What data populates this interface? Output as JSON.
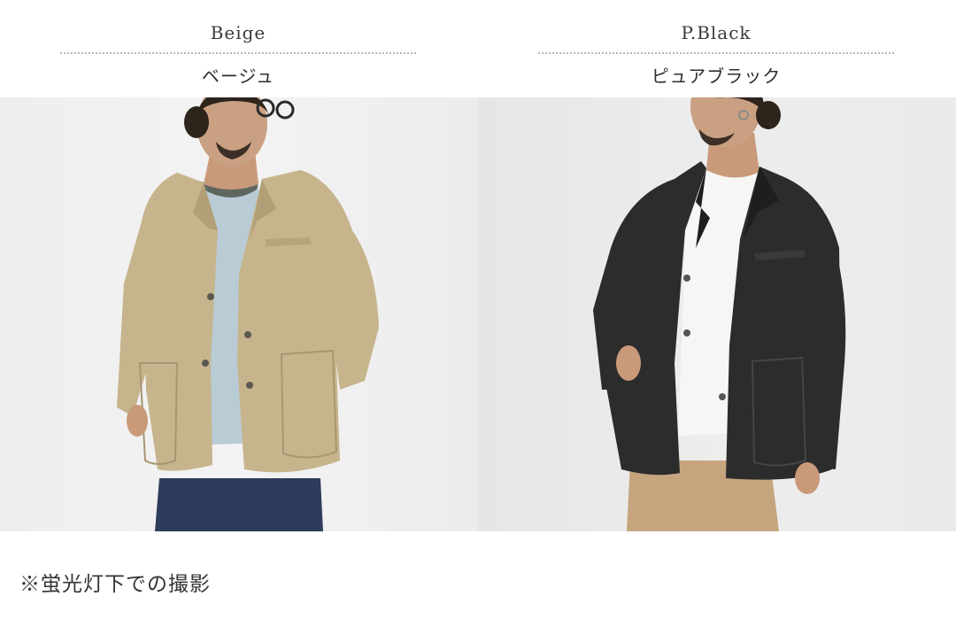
{
  "colors": {
    "left": {
      "label_en": "Beige",
      "label_jp": "ベージュ",
      "jacket": "#c6b48c",
      "shirt": "#b9cbd4",
      "pants": "#2f3b5c"
    },
    "right": {
      "label_en": "P.Black",
      "label_jp": "ピュアブラック",
      "jacket": "#2c2c2c",
      "shirt": "#f6f6f4",
      "pants": "#c6a57e"
    }
  },
  "note": "※蛍光灯下での撮影"
}
